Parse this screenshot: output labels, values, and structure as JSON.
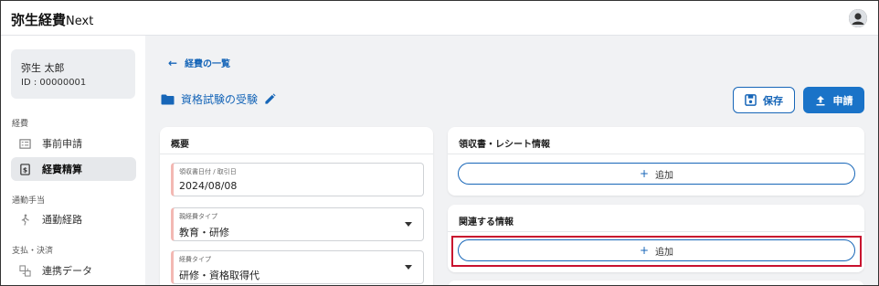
{
  "app": {
    "title": "弥生経費",
    "title_suffix": "Next"
  },
  "user": {
    "name": "弥生 太郎",
    "id_label": "ID : 00000001"
  },
  "sidebar": {
    "sections": [
      {
        "label": "経費",
        "items": [
          {
            "label": "事前申請",
            "icon": "checklist-icon"
          },
          {
            "label": "経費精算",
            "icon": "receipt-icon",
            "active": true
          }
        ]
      },
      {
        "label": "通勤手当",
        "items": [
          {
            "label": "通勤経路",
            "icon": "walking-person-icon"
          }
        ]
      },
      {
        "label": "支払・決済",
        "items": [
          {
            "label": "連携データ",
            "icon": "linked-data-icon"
          }
        ]
      }
    ]
  },
  "main": {
    "back_link": "経費の一覧",
    "title": "資格試験の受験",
    "save_label": "保存",
    "apply_label": "申請",
    "overview": {
      "title": "概要",
      "fields": [
        {
          "label": "領収書日付 / 取引日",
          "value": "2024/08/08",
          "dropdown": false
        },
        {
          "label": "親経費タイプ",
          "value": "教育・研修",
          "dropdown": true
        },
        {
          "label": "経費タイプ",
          "value": "研修・資格取得代",
          "dropdown": true
        }
      ]
    },
    "receipt_card": {
      "title": "領収書・レシート情報",
      "add_label": "追加"
    },
    "related_card": {
      "title": "関連する情報",
      "add_label": "追加"
    }
  },
  "colors": {
    "accent": "#1766b8",
    "primary_button": "#1a73c8",
    "highlight": "#c8102e",
    "required_marker": "#f3b8b3"
  }
}
